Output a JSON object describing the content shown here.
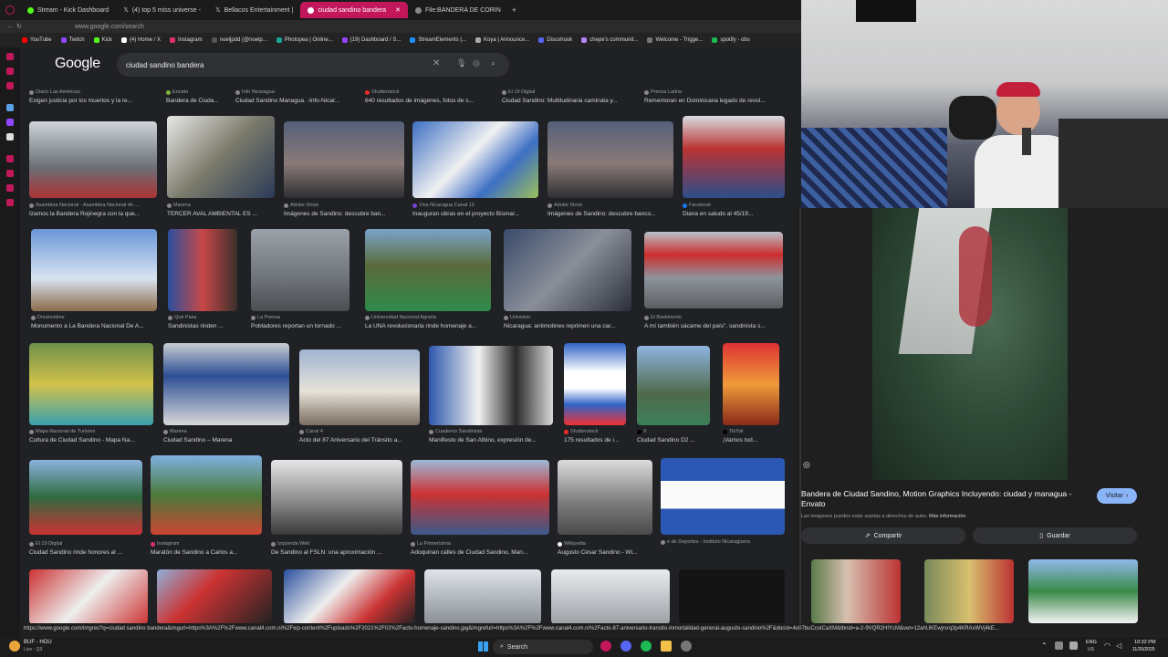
{
  "tabs": [
    {
      "label": "Stream - Kick Dashboard",
      "color": "#53fc18"
    },
    {
      "label": "(4) top 5 miss universe -",
      "color": "#ffffff"
    },
    {
      "label": "Bellacos Entertainment |",
      "color": "#ffffff"
    },
    {
      "label": "ciudad sandino bandera",
      "color": "#ffffff",
      "active": true
    },
    {
      "label": "File:BANDERA DE CORIN",
      "color": "#888888"
    }
  ],
  "address": "www.google.com/search",
  "bookmarks": [
    "YouTube",
    "Twitch",
    "Kick",
    "(4) Home / X",
    "Instagram",
    "noeljpdd (@noelp...",
    "Photopea | Online...",
    "(19) Dashboard / S...",
    "StreamElements |...",
    "Koya | Announce...",
    "Discohook",
    "chepe's communit...",
    "Welcome - Trigge...",
    "spotify - obs"
  ],
  "google": {
    "logo": "Google",
    "query": "ciudad sandino bandera"
  },
  "top_row": [
    {
      "source": "Diario Las Américas",
      "title": "Exigen justicia por los muertos y la re..."
    },
    {
      "source": "Envato",
      "title": "Bandera de Ciuda..."
    },
    {
      "source": "Info Nicaragua",
      "title": "Ciudad Sandino Managua. -Info-Nicar..."
    },
    {
      "source": "Shutterstock",
      "title": "640 resultados de imágenes, fotos de s..."
    },
    {
      "source": "El 19 Digital",
      "title": "Ciudad Sandino: Multitudinaria caminata y..."
    },
    {
      "source": "Prensa Latina",
      "title": "Rememoran en Dominicana legado de revol..."
    }
  ],
  "rows": [
    [
      {
        "source": "Asamblea Nacional - Asamblea Nacional de ...",
        "title": "Izamos la Bandera Rojinegra con la que..."
      },
      {
        "source": "Marena",
        "title": "TERCER AVAL AMBIENTAL ES ..."
      },
      {
        "source": "Adobe Stock",
        "title": "Imágenes de Sandino: descubre ban..."
      },
      {
        "source": "Viva Nicaragua Canal 13",
        "title": "Inauguran obras en el proyecto Bismar..."
      },
      {
        "source": "Adobe Stock",
        "title": "Imágenes de Sandino: descubre banco..."
      },
      {
        "source": "Facebook",
        "title": "Diana en saludo al 45/19..."
      }
    ],
    [
      {
        "source": "Dreamstime",
        "title": "Monumento a La Bandera Nacional De A..."
      },
      {
        "source": "Qué Pasa",
        "title": "Sandinistas rinden ..."
      },
      {
        "source": "La Prensa",
        "title": "Pobladores reportan un tornado ..."
      },
      {
        "source": "Universidad Nacional Agraria",
        "title": "La UNA revolucionaria rinde homenaje a..."
      },
      {
        "source": "Univision",
        "title": "Nicaragua: antimotines reprimen una car..."
      },
      {
        "source": "El Bastimento",
        "title": "A mí también sácame del país\", sandinista s..."
      }
    ],
    [
      {
        "source": "Mapa Nacional de Turismo",
        "title": "Cultura de Ciudad Sandino - Mapa Na..."
      },
      {
        "source": "Marena",
        "title": "Ciudad Sandino – Marena"
      },
      {
        "source": "Canal 4",
        "title": "Acto del 87 Aniversario del Tránsito a..."
      },
      {
        "source": "Cuaderno Sandinista",
        "title": "Manifiesto de San Albino, expresión de..."
      },
      {
        "source": "Shutterstock",
        "title": "175 resultados de i..."
      },
      {
        "source": "X",
        "title": "Ciudad Sandino D2 ..."
      },
      {
        "source": "TikTok",
        "title": "¡Vamos tod..."
      }
    ],
    [
      {
        "source": "El 19 Digital",
        "title": "Ciudad Sandino rinde honores al ..."
      },
      {
        "source": "Instagram",
        "title": "Maratón de Sandino a Carlos a..."
      },
      {
        "source": "Izquierda Web",
        "title": "De Sandino al FSLN: una aproximación ..."
      },
      {
        "source": "La Primerísima",
        "title": "Adoquinan calles de Ciudad Sandino, Man..."
      },
      {
        "source": "Wikipedia",
        "title": "Augusto César Sandino - Wi..."
      },
      {
        "source": "e de Deportes - Instituto Nicaragüens",
        "title": "e de Deportes - Instituto Nicaragüens"
      }
    ]
  ],
  "panel": {
    "title": "Bandera de Ciudad Sandino, Motion Graphics Incluyendo: ciudad y managua - Envato",
    "visit": "Visitar",
    "note": "Las imágenes pueden estar sujetas a derechos de autor.",
    "note_link": "Más información",
    "share": "Compartir",
    "save": "Guardar"
  },
  "status_url": "https://www.google.com/imgres?q=ciudad sandino bandera&imgurl=https%3A%2F%2Fwww.canal4.com.ni%2Fwp-content%2Fuploads%2F2021%2F02%2Facto-homenaje-sandino.jpg&imgrefurl=https%3A%2F%2Fwww.canal4.com.ni%2Facto-87-aniversario-transito-inmortalidad-general-augusto-sandino%2F&docid=4o07buCcoiCaXM&tbnid=a-2-9VQR2HIYcM&vet=12ahUKEwjrsrq3p4KRAxWVj4kE...",
  "taskbar": {
    "weather": "BUF - HOU",
    "weather_sub": "Live - Q3",
    "search": "Search",
    "lang": "ENG",
    "lang_sub": "US",
    "time": "10:32 PM",
    "date": "11/20/2025"
  },
  "colors": {
    "accent": "#c2185b",
    "bg": "#202124",
    "link": "#8ab4f8"
  }
}
